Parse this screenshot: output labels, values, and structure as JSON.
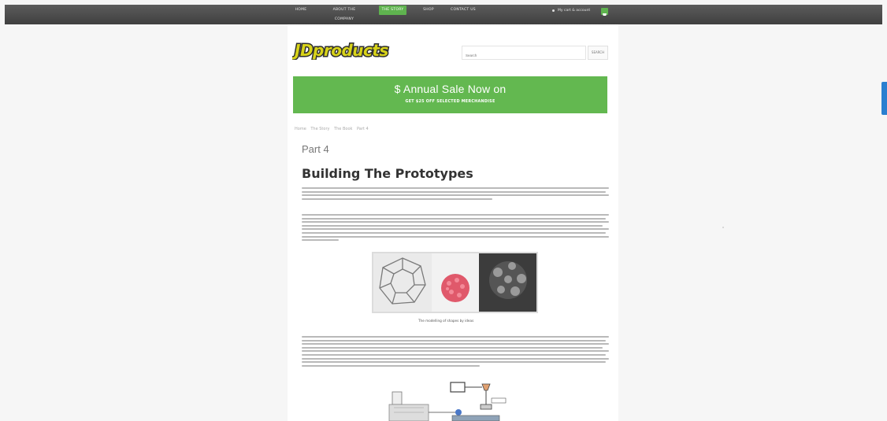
{
  "nav": {
    "items": [
      {
        "label": "HOME",
        "active": false
      },
      {
        "label": "ABOUT THE COMPANY",
        "active": false
      },
      {
        "label": "THE STORY",
        "active": true
      },
      {
        "label": "SHOP",
        "active": false
      },
      {
        "label": "CONTACT US",
        "active": false
      }
    ],
    "account_label": "My cart & account",
    "cart_icon": "cart-icon"
  },
  "header": {
    "logo_text": "JDproducts",
    "search_placeholder": "Search",
    "search_button": "SEARCH"
  },
  "banner": {
    "title": "$ Annual Sale Now on",
    "subtitle": "GET $25 OFF SELECTED MERCHANDISE"
  },
  "breadcrumb": [
    "Home",
    "The Story",
    "The Book",
    "Part 4"
  ],
  "article": {
    "part_title": "Part 4",
    "heading": "Building The Prototypes",
    "figure_caption": "The modelling of shapes by ideas"
  },
  "colors": {
    "nav_bg": "#4a4a4a",
    "accent_green": "#63b850",
    "side_tab_blue": "#2a7fd0"
  }
}
